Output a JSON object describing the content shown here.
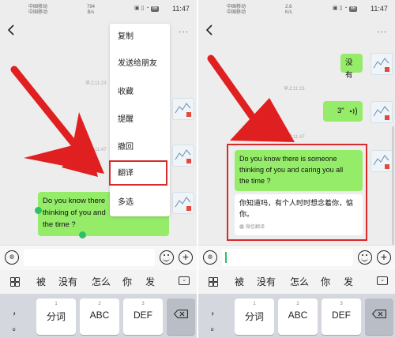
{
  "status_bar": {
    "carrier_line1": "中国移动",
    "carrier_line2": "中国移动",
    "left_netspeed": "794",
    "left_netspeed_unit": "B/s",
    "right_netspeed": "2.6",
    "right_netspeed_unit": "K/s",
    "battery": "86",
    "time": "11:47"
  },
  "chat": {
    "more_label": "···",
    "timestamps": [
      "早上11:23",
      "早上11:47"
    ],
    "left_message": "Do you know there is someone thinking of you and caring you all the time ?",
    "left_visible_line1": "Do you know there",
    "left_visible_line2": "thinking of you and",
    "left_visible_line3": "the time ?",
    "right_msg_1": "没有",
    "right_voice": "3\"",
    "right_msg_line1": "Do you know there is someone",
    "right_msg_line2": "thinking of you and caring you all",
    "right_msg_line3": "the time ?",
    "translation_line1": "你知道吗，有个人时时想念着你，惦",
    "translation_line2": "你。",
    "translation_note": "微信翻译"
  },
  "context_menu": {
    "items": [
      "复制",
      "发送给朋友",
      "收藏",
      "提醒",
      "撤回",
      "翻译",
      "多选"
    ],
    "highlighted": "翻译"
  },
  "suggestions": [
    "被",
    "没有",
    "怎么",
    "你",
    "发"
  ],
  "keyboard": {
    "keys": [
      {
        "num": "",
        "label": "，",
        "label2": "。"
      },
      {
        "num": "1",
        "label": "分词"
      },
      {
        "num": "2",
        "label": "ABC"
      },
      {
        "num": "3",
        "label": "DEF"
      }
    ]
  },
  "colors": {
    "bubble_green": "#95ec69",
    "annotation_red": "#d82a2a",
    "chat_background": "#ededed",
    "selection_green": "#2ec067"
  },
  "icons": [
    "back-arrow-icon",
    "more-icon",
    "voice-icon",
    "emoji-icon",
    "plus-icon",
    "grid-icon",
    "keyboard-collapse-icon",
    "backspace-icon",
    "speaker-wave-icon"
  ]
}
